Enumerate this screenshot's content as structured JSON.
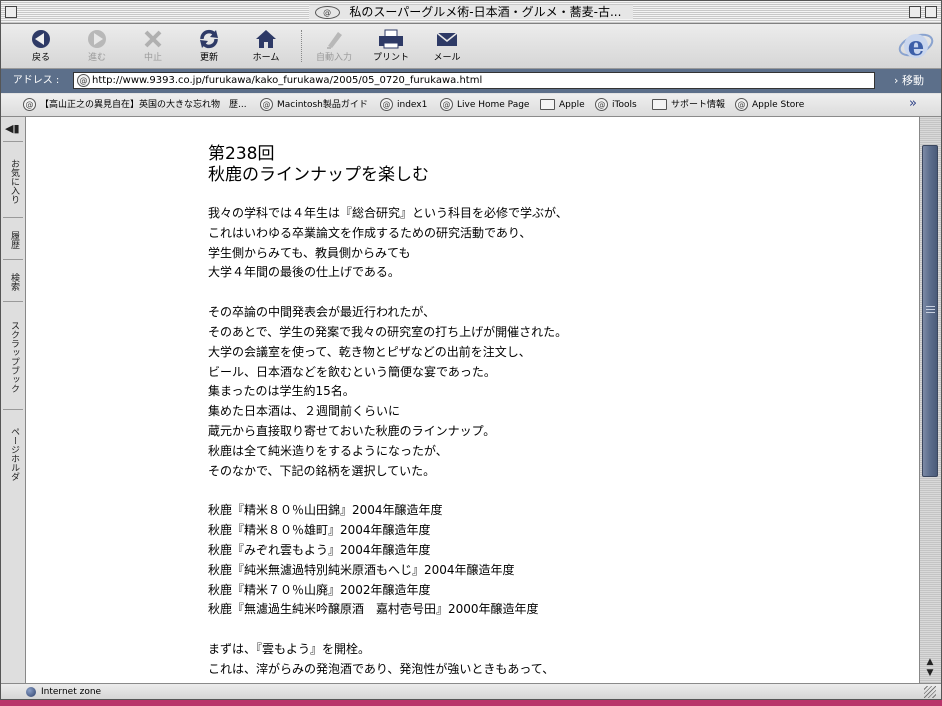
{
  "window": {
    "title": "私のスーパーグルメ術-日本酒・グルメ・蕎麦-古..."
  },
  "toolbar": {
    "buttons": [
      {
        "label": "戻る",
        "icon": "back-arrow-icon",
        "enabled": true
      },
      {
        "label": "進む",
        "icon": "forward-arrow-icon",
        "enabled": false
      },
      {
        "label": "中止",
        "icon": "stop-icon",
        "enabled": false
      },
      {
        "label": "更新",
        "icon": "refresh-icon",
        "enabled": true
      },
      {
        "label": "ホーム",
        "icon": "home-icon",
        "enabled": true
      },
      {
        "label": "自動入力",
        "icon": "autofill-icon",
        "enabled": false
      },
      {
        "label": "プリント",
        "icon": "print-icon",
        "enabled": true
      },
      {
        "label": "メール",
        "icon": "mail-icon",
        "enabled": true
      }
    ]
  },
  "address": {
    "label": "アドレス :",
    "url": "http://www.9393.co.jp/furukawa/kako_furukawa/2005/05_0720_furukawa.html",
    "go_label": "移動"
  },
  "favorites": [
    {
      "label": "【高山正之の異見自在】英国の大きな忘れ物　歴...",
      "icon": "at-icon"
    },
    {
      "label": "Macintosh製品ガイド",
      "icon": "at-icon"
    },
    {
      "label": "index1",
      "icon": "at-icon"
    },
    {
      "label": "Live Home Page",
      "icon": "at-icon"
    },
    {
      "label": "Apple",
      "icon": "folder-icon"
    },
    {
      "label": "iTools",
      "icon": "at-icon"
    },
    {
      "label": "サポート情報",
      "icon": "folder-icon"
    },
    {
      "label": "Apple Store",
      "icon": "at-icon"
    }
  ],
  "sidebar_tabs": [
    "お気に入り",
    "履歴",
    "検索",
    "スクラップブック",
    "ページホルダ"
  ],
  "article": {
    "episode": "第238回",
    "title": "秋鹿のラインナップを楽しむ",
    "paragraphs": [
      [
        "我々の学科では４年生は『総合研究』という科目を必修で学ぶが、",
        "これはいわゆる卒業論文を作成するための研究活動であり、",
        "学生側からみても、教員側からみても",
        "大学４年間の最後の仕上げである。"
      ],
      [
        "その卒論の中間発表会が最近行われたが、",
        "そのあとで、学生の発案で我々の研究室の打ち上げが開催された。",
        "大学の会議室を使って、乾き物とピザなどの出前を注文し、",
        "ビール、日本酒などを飲むという簡便な宴であった。",
        "集まったのは学生約15名。",
        "集めた日本酒は、２週間前くらいに",
        "蔵元から直接取り寄せておいた秋鹿のラインナップ。",
        "秋鹿は全て純米造りをするようになったが、",
        "そのなかで、下記の銘柄を選択していた。"
      ],
      [
        "秋鹿『精米８０％山田錦』2004年醸造年度",
        "秋鹿『精米８０％雄町』2004年醸造年度",
        "秋鹿『みぞれ雲もよう』2004年醸造年度",
        "秋鹿『純米無濾過特別純米原酒もへじ』2004年醸造年度",
        "秋鹿『精米７０％山廃』2002年醸造年度",
        "秋鹿『無濾過生純米吟醸原酒　嘉村壱号田』2000年醸造年度"
      ],
      [
        "まずは、『雲もよう』を開栓。",
        "これは、滓がらみの発泡酒であり、発泡性が強いときもあって、"
      ]
    ]
  },
  "status": {
    "zone": "Internet zone"
  },
  "colors": {
    "address_bar": "#5c6f8a",
    "scroll_thumb": "#5c6d8c",
    "desktop": "#b9346a"
  }
}
